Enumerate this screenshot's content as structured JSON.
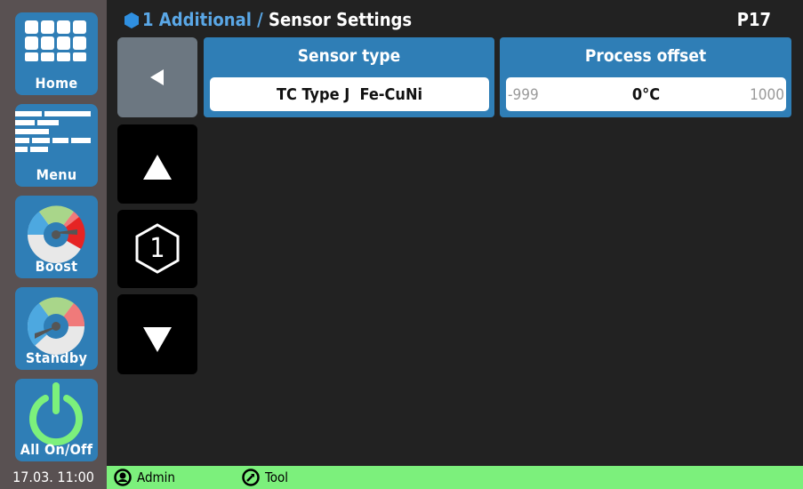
{
  "sidebar": {
    "items": [
      {
        "label": "Home"
      },
      {
        "label": "Menu"
      },
      {
        "label": "Boost"
      },
      {
        "label": "Standby"
      },
      {
        "label": "All On/Off"
      }
    ]
  },
  "header": {
    "breadcrumb_parent": "1 Additional",
    "breadcrumb_separator": "/",
    "breadcrumb_current": "Sensor Settings",
    "page_code": "P17"
  },
  "nav": {
    "slot_number": "1"
  },
  "params": {
    "sensor_type": {
      "title": "Sensor type",
      "value": "TC Type J  Fe-CuNi"
    },
    "process_offset": {
      "title": "Process offset",
      "min": "-999",
      "value": "0°C",
      "max": "1000"
    }
  },
  "status": {
    "datetime": "17.03. 11:00",
    "user": "Admin",
    "tool": "Tool"
  },
  "colors": {
    "accent": "#2f7eb6",
    "sidebar": "#595152",
    "status_ok": "#7cf07c",
    "boost_red": "#e62424"
  }
}
